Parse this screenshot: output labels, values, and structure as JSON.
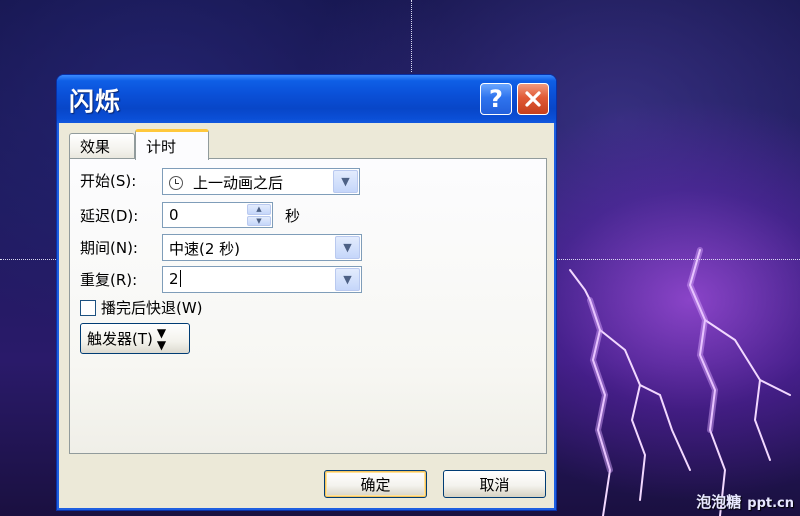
{
  "background": {
    "watermark_cn": "泡泡糖",
    "watermark_en": "ppt.cn"
  },
  "dialog": {
    "title": "闪烁",
    "help_button": "?",
    "close_button_icon": "close-x",
    "tabs": [
      {
        "label": "效果",
        "active": false
      },
      {
        "label": "计时",
        "active": true
      }
    ],
    "start": {
      "label": "开始(S):",
      "value": "上一动画之后",
      "icon": "clock-icon"
    },
    "delay": {
      "label": "延迟(D):",
      "value": "0",
      "unit": "秒"
    },
    "duration": {
      "label": "期间(N):",
      "value": "中速(2 秒)"
    },
    "repeat": {
      "label": "重复(R):",
      "value": "2"
    },
    "rewind": {
      "label": "播完后快退(W)",
      "checked": false
    },
    "trigger_button": "触发器(T)",
    "ok_button": "确定",
    "cancel_button": "取消"
  },
  "colors": {
    "titlebar": "#0a50d8",
    "dialog_face": "#ece9d8",
    "close_red": "#e15a36",
    "active_tab_accent": "#ffc83c"
  }
}
